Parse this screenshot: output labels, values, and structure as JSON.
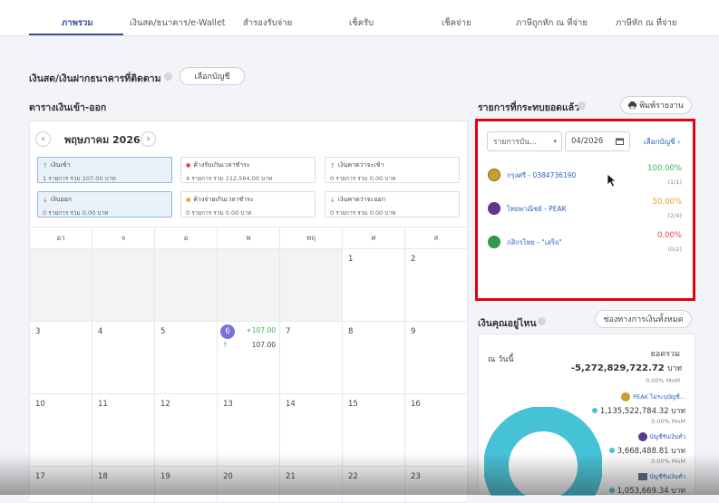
{
  "tabs": [
    "ภาพรวม",
    "เงินสด/ธนาคาร/e-Wallet",
    "สำรองรับจ่าย",
    "เช็ครับ",
    "เช็คจ่าย",
    "ภาษีถูกหัก ณ ที่จ่าย",
    "ภาษีหัก ณ ที่จ่าย"
  ],
  "tracked": {
    "title": "เงินสด/เงินฝากธนาคารที่ติดตาม",
    "button": "เลือกบัญชี"
  },
  "cashflow": {
    "title": "ตารางเงินเข้า-ออก",
    "month": "พฤษภาคม 2026",
    "prev_icon": "‹",
    "next_icon": "›",
    "stats": [
      {
        "title": "เงินเข้า",
        "sub": "1 รายการ รวม 107.00 บาท",
        "color": "#3db25a",
        "icon": "↑"
      },
      {
        "title": "ค้างรับเกินเวลาชำระ",
        "sub": "4 รายการ รวม 112,564.00 บาท",
        "color": "#e04848",
        "icon": "●"
      },
      {
        "title": "เงินคาดว่าจะเข้า",
        "sub": "0 รายการ รวม 0.00 บาท",
        "color": "#3db25a",
        "icon": "↑"
      },
      {
        "title": "เงินออก",
        "sub": "0 รายการ รวม 0.00 บาท",
        "color": "#e04848",
        "icon": "↓"
      },
      {
        "title": "ค้างจ่ายเกินเวลาชำระ",
        "sub": "0 รายการ รวม 0.00 บาท",
        "color": "#f0a020",
        "icon": "●"
      },
      {
        "title": "เงินคาดว่าจะออก",
        "sub": "0 รายการ รวม 0.00 บาท",
        "color": "#e04848",
        "icon": "↓"
      }
    ],
    "weekdays": [
      "อา",
      "จ",
      "อ",
      "พ",
      "พฤ",
      "ศ",
      "ส"
    ],
    "today_amount": "+107.00",
    "today_line": "107.00",
    "today_icon": "↑"
  },
  "reconciled": {
    "title": "รายการที่กระทบยอดแล้ว",
    "print_button": "พิมพ์รายงาน",
    "print_icon": "printer-icon",
    "filter_select": "รายการบัน...",
    "date_value": "04/2026",
    "choose_link": "เลือกบัญชี",
    "accounts": [
      {
        "name": "กรุงศรี - 0384736190",
        "pct": "100.00%",
        "count": "(1/1)",
        "pct_color": "#3db25a",
        "icon_color": "#c8a030"
      },
      {
        "name": "ไทยพาณิชย์ - PEAK",
        "pct": "50.00%",
        "count": "(2/4)",
        "pct_color": "#f0a020",
        "icon_color": "#5a3a8a"
      },
      {
        "name": "กสิกรไทย - \"เสร็จ\"",
        "pct": "0.00%",
        "count": "(0/2)",
        "pct_color": "#e04848",
        "icon_color": "#2f9a4a"
      }
    ]
  },
  "where": {
    "title": "เงินคุณอยู่ไหน",
    "button": "ช่องทางการเงินทั้งหมด",
    "total_label": "ยอดรวม",
    "as_of": "ณ วันนี้",
    "total_value": "-5,272,829,722.72",
    "unit": "บาท",
    "mom": "0.00% MoM",
    "items": [
      {
        "name": "PEAK ไม่ระบุบัญชี...",
        "value": "1,135,522,784.32",
        "unit": "บาท",
        "mom": "0.00% MoM",
        "color": "#46c2d6"
      },
      {
        "name": "บัญชีรับเงินทั่ว",
        "value": "3,668,488.81",
        "unit": "บาท",
        "mom": "0.00% MoM",
        "color": "#46c2d6"
      },
      {
        "name": "บัญชีรับเงินทั่ว",
        "value": "1,053,669.34",
        "unit": "บาท",
        "mom": "",
        "color": "#46c2d6"
      }
    ]
  }
}
